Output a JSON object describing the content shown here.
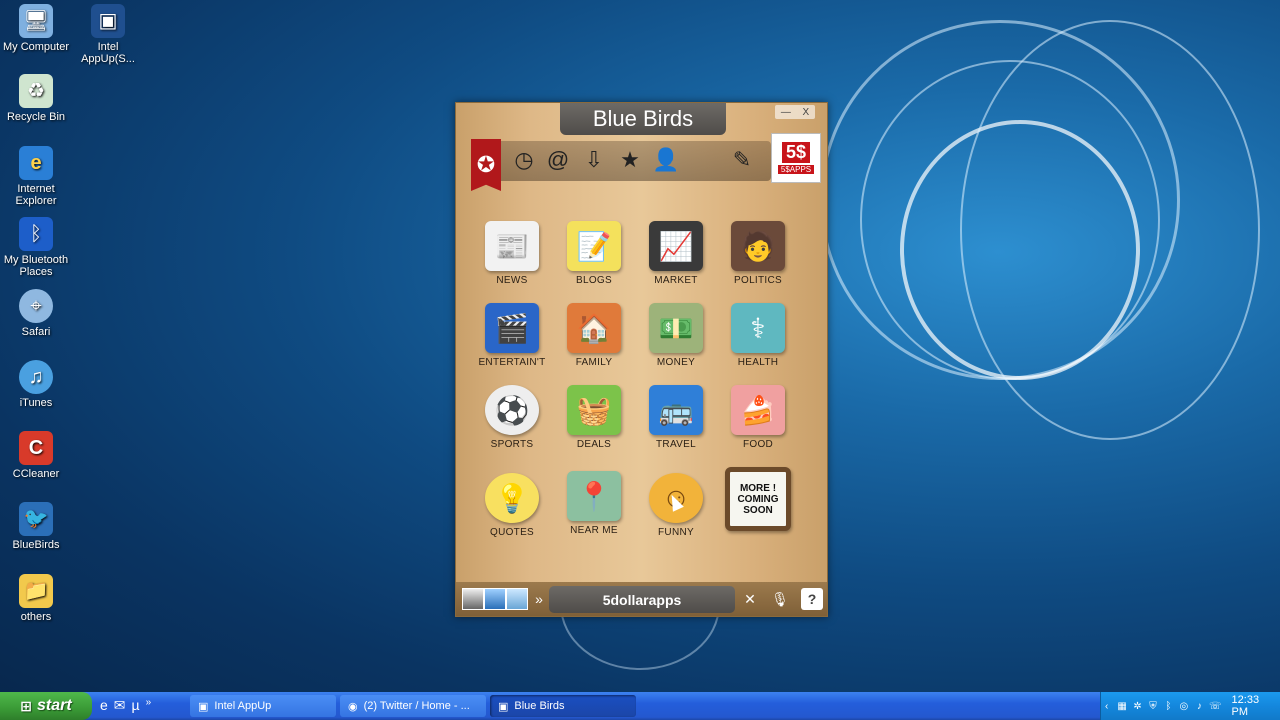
{
  "desktop": {
    "icons": [
      {
        "label": "My Computer",
        "glyph": "🖥",
        "color": "#7fb0e0"
      },
      {
        "label": "Intel AppUp(S...",
        "glyph": "⬛",
        "color": "#1f4f8f"
      },
      {
        "label": "Recycle Bin",
        "glyph": "♻",
        "color": "#cfe5cf"
      },
      {
        "label": "Internet Explorer",
        "glyph": "e",
        "color": "#2a7fd6"
      },
      {
        "label": "My Bluetooth Places",
        "glyph": "ᛒ",
        "color": "#1d5ec9"
      },
      {
        "label": "Safari",
        "glyph": "⌖",
        "color": "#8fb8e0"
      },
      {
        "label": "iTunes",
        "glyph": "♫",
        "color": "#4aa0e0"
      },
      {
        "label": "CCleaner",
        "glyph": "C",
        "color": "#d83a2a"
      },
      {
        "label": "BlueBirds",
        "glyph": "🐦",
        "color": "#2b6fb8"
      },
      {
        "label": "others",
        "glyph": "📁",
        "color": "#f2c94c"
      }
    ]
  },
  "app": {
    "title": "Blue Birds",
    "window_controls": {
      "minimize": "—",
      "close": "X"
    },
    "tabs": [
      {
        "name": "world",
        "glyph": "✪"
      },
      {
        "name": "recent",
        "glyph": "◷"
      },
      {
        "name": "mentions",
        "glyph": "@"
      },
      {
        "name": "inbox",
        "glyph": "⇩"
      },
      {
        "name": "favorites",
        "glyph": "★"
      },
      {
        "name": "profile",
        "glyph": "👤"
      },
      {
        "name": "compose",
        "glyph": "✎"
      }
    ],
    "logo": {
      "big": "5$",
      "small": "5$APPS"
    },
    "categories": [
      {
        "label": "NEWS",
        "glyph": "📰",
        "bg": "#f2f2f2"
      },
      {
        "label": "BLOGS",
        "glyph": "📝",
        "bg": "#f4e15c"
      },
      {
        "label": "MARKET",
        "glyph": "📈",
        "bg": "#3a3a3a"
      },
      {
        "label": "POLITICS",
        "glyph": "🧑",
        "bg": "#6b4a3a"
      },
      {
        "label": "ENTERTAIN'T",
        "glyph": "🎬",
        "bg": "#2a66c8"
      },
      {
        "label": "FAMILY",
        "glyph": "🏠",
        "bg": "#e07a3a"
      },
      {
        "label": "MONEY",
        "glyph": "💵",
        "bg": "#9db37a"
      },
      {
        "label": "HEALTH",
        "glyph": "⚕",
        "bg": "#5fb8c0"
      },
      {
        "label": "SPORTS",
        "glyph": "⚽",
        "bg": "#eeeeee"
      },
      {
        "label": "DEALS",
        "glyph": "🧺",
        "bg": "#7cc34a"
      },
      {
        "label": "TRAVEL",
        "glyph": "🚌",
        "bg": "#2f7fd8"
      },
      {
        "label": "FOOD",
        "glyph": "🍰",
        "bg": "#f0a0a0"
      },
      {
        "label": "QUOTES",
        "glyph": "💡",
        "bg": "#f8e060"
      },
      {
        "label": "NEAR ME",
        "glyph": "📍",
        "bg": "#8cc0a0"
      },
      {
        "label": "FUNNY",
        "glyph": "☺",
        "bg": "#f2b33a"
      },
      {
        "label": "MORE ! COMING SOON",
        "glyph": "",
        "bg": "#f6f6f0"
      }
    ],
    "bottom": {
      "brand": "5dollarapps"
    }
  },
  "taskbar": {
    "start_label": "start",
    "tasks": [
      {
        "label": "Intel AppUp"
      },
      {
        "label": "(2) Twitter / Home - ..."
      },
      {
        "label": "Blue Birds"
      }
    ],
    "clock": "12:33 PM"
  }
}
